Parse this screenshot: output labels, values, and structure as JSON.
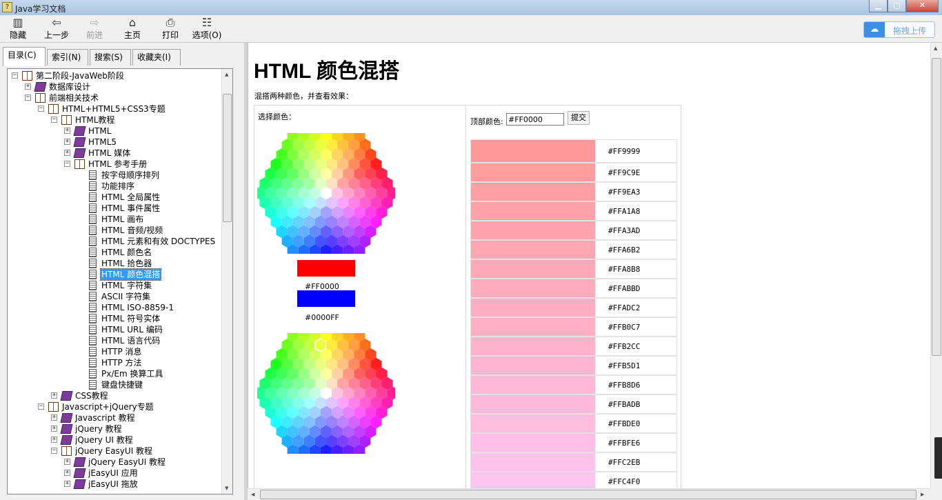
{
  "window": {
    "title": "Java学习文档",
    "icon": "help-book-icon",
    "controls": [
      "minimize",
      "maximize",
      "close"
    ]
  },
  "toolbar": {
    "items": [
      {
        "id": "hide",
        "label": "隐藏",
        "icon": "hide-pane-icon",
        "enabled": true
      },
      {
        "id": "back",
        "label": "上一步",
        "icon": "back-arrow-icon",
        "enabled": true
      },
      {
        "id": "forward",
        "label": "前进",
        "icon": "forward-arrow-icon",
        "enabled": false
      },
      {
        "id": "home",
        "label": "主页",
        "icon": "home-icon",
        "enabled": true
      },
      {
        "id": "print",
        "label": "打印",
        "icon": "printer-icon",
        "enabled": true
      },
      {
        "id": "options",
        "label": "选项(O)",
        "icon": "options-icon",
        "enabled": true
      }
    ],
    "baidu_upload": "拖拽上传"
  },
  "nav_tabs": [
    {
      "label": "目录(C)",
      "active": true
    },
    {
      "label": "索引(N)",
      "active": false
    },
    {
      "label": "搜索(S)",
      "active": false
    },
    {
      "label": "收藏夹(I)",
      "active": false
    }
  ],
  "tree": [
    {
      "label": "第二阶段-JavaWeb阶段",
      "depth": 0,
      "toggle": "-",
      "icon": "open"
    },
    {
      "label": "数据库设计",
      "depth": 1,
      "toggle": "+",
      "icon": "closed"
    },
    {
      "label": "前端相关技术",
      "depth": 1,
      "toggle": "-",
      "icon": "open"
    },
    {
      "label": "HTML+HTML5+CSS3专题",
      "depth": 2,
      "toggle": "-",
      "icon": "open"
    },
    {
      "label": "HTML教程",
      "depth": 3,
      "toggle": "-",
      "icon": "open"
    },
    {
      "label": "HTML",
      "depth": 4,
      "toggle": "+",
      "icon": "closed"
    },
    {
      "label": "HTML5",
      "depth": 4,
      "toggle": "+",
      "icon": "closed"
    },
    {
      "label": "HTML 媒体",
      "depth": 4,
      "toggle": "+",
      "icon": "closed"
    },
    {
      "label": "HTML 参考手册",
      "depth": 4,
      "toggle": "-",
      "icon": "open"
    },
    {
      "label": "按字母顺序排列",
      "depth": 5,
      "toggle": "",
      "icon": "page"
    },
    {
      "label": "功能排序",
      "depth": 5,
      "toggle": "",
      "icon": "page"
    },
    {
      "label": "HTML 全局属性",
      "depth": 5,
      "toggle": "",
      "icon": "page"
    },
    {
      "label": "HTML 事件属性",
      "depth": 5,
      "toggle": "",
      "icon": "page"
    },
    {
      "label": "HTML 画布",
      "depth": 5,
      "toggle": "",
      "icon": "page"
    },
    {
      "label": "HTML 音频/视频",
      "depth": 5,
      "toggle": "",
      "icon": "page"
    },
    {
      "label": "HTML 元素和有效 DOCTYPES",
      "depth": 5,
      "toggle": "",
      "icon": "page"
    },
    {
      "label": "HTML 颜色名",
      "depth": 5,
      "toggle": "",
      "icon": "page"
    },
    {
      "label": "HTML 拾色器",
      "depth": 5,
      "toggle": "",
      "icon": "page"
    },
    {
      "label": "HTML 颜色混搭",
      "depth": 5,
      "toggle": "",
      "icon": "page",
      "selected": true
    },
    {
      "label": "HTML 字符集",
      "depth": 5,
      "toggle": "",
      "icon": "page"
    },
    {
      "label": "ASCII 字符集",
      "depth": 5,
      "toggle": "",
      "icon": "page"
    },
    {
      "label": "HTML ISO-8859-1",
      "depth": 5,
      "toggle": "",
      "icon": "page"
    },
    {
      "label": "HTML 符号实体",
      "depth": 5,
      "toggle": "",
      "icon": "page"
    },
    {
      "label": "HTML URL 编码",
      "depth": 5,
      "toggle": "",
      "icon": "page"
    },
    {
      "label": "HTML 语言代码",
      "depth": 5,
      "toggle": "",
      "icon": "page"
    },
    {
      "label": "HTTP 消息",
      "depth": 5,
      "toggle": "",
      "icon": "page"
    },
    {
      "label": "HTTP 方法",
      "depth": 5,
      "toggle": "",
      "icon": "page"
    },
    {
      "label": "Px/Em 换算工具",
      "depth": 5,
      "toggle": "",
      "icon": "page"
    },
    {
      "label": "键盘快捷键",
      "depth": 5,
      "toggle": "",
      "icon": "page"
    },
    {
      "label": "CSS教程",
      "depth": 3,
      "toggle": "+",
      "icon": "closed"
    },
    {
      "label": "Javascript+jQuery专题",
      "depth": 2,
      "toggle": "-",
      "icon": "open"
    },
    {
      "label": "Javascript 教程",
      "depth": 3,
      "toggle": "+",
      "icon": "closed"
    },
    {
      "label": "jQuery 教程",
      "depth": 3,
      "toggle": "+",
      "icon": "closed"
    },
    {
      "label": "jQuery UI 教程",
      "depth": 3,
      "toggle": "+",
      "icon": "closed"
    },
    {
      "label": "jQuery EasyUI 教程",
      "depth": 3,
      "toggle": "-",
      "icon": "open"
    },
    {
      "label": "jQuery EasyUI 教程",
      "depth": 4,
      "toggle": "+",
      "icon": "closed"
    },
    {
      "label": "jEasyUI 应用",
      "depth": 4,
      "toggle": "+",
      "icon": "closed"
    },
    {
      "label": "jEasyUI 拖放",
      "depth": 4,
      "toggle": "+",
      "icon": "closed"
    }
  ],
  "content": {
    "title": "HTML 颜色混搭",
    "intro": "混搭两种颜色，并查看效果：",
    "pick_label": "选择颜色：",
    "color1": {
      "hex": "#FF0000",
      "swatch": "#ff0000"
    },
    "color2": {
      "hex": "#0000FF",
      "swatch": "#0000ff"
    },
    "top_color_label": "顶部颜色:",
    "top_color_value": "#FF0000",
    "submit_label": "提交",
    "mix_rows": [
      "#FF9999",
      "#FF9C9E",
      "#FF9EA3",
      "#FFA1A8",
      "#FFA3AD",
      "#FFA6B2",
      "#FFA8B8",
      "#FFABBD",
      "#FFADC2",
      "#FFB0C7",
      "#FFB2CC",
      "#FFB5D1",
      "#FFB8D6",
      "#FFBADB",
      "#FFBDE0",
      "#FFBFE6",
      "#FFC2EB",
      "#FFC4F0"
    ]
  }
}
